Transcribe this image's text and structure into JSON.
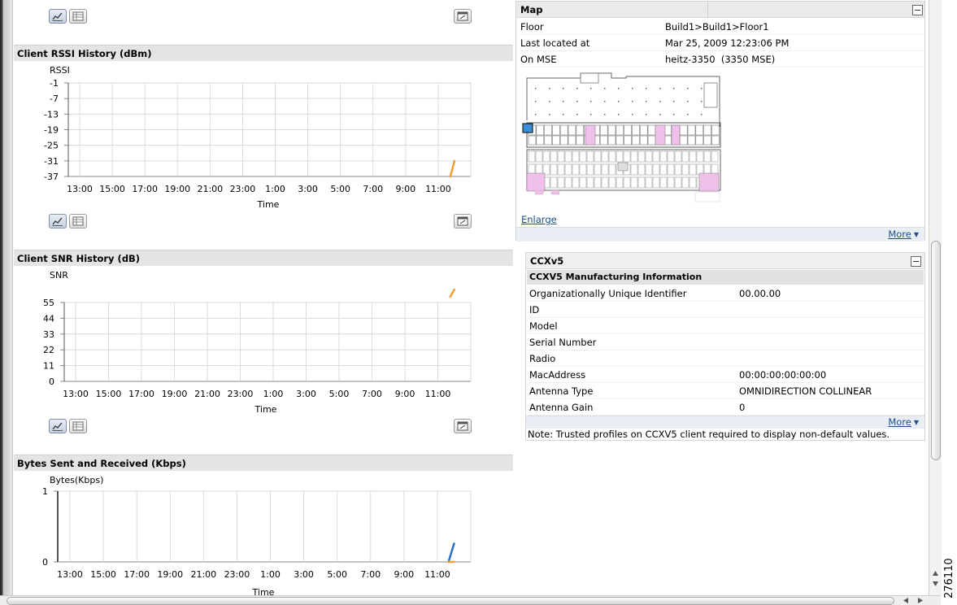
{
  "charts": {
    "rssi": {
      "title": "Client RSSI History (dBm)",
      "ylabel": "RSSI",
      "xlabel": "Time",
      "yticks": [
        "-1",
        "-7",
        "-13",
        "-19",
        "-25",
        "-31",
        "-37"
      ],
      "xticks": [
        "13:00",
        "15:00",
        "17:00",
        "19:00",
        "21:00",
        "23:00",
        "1:00",
        "3:00",
        "5:00",
        "7:00",
        "9:00",
        "11:00"
      ]
    },
    "snr": {
      "title": "Client SNR History (dB)",
      "ylabel": "SNR",
      "xlabel": "Time",
      "yticks": [
        "55",
        "44",
        "33",
        "22",
        "11",
        "0"
      ],
      "xticks": [
        "13:00",
        "15:00",
        "17:00",
        "19:00",
        "21:00",
        "23:00",
        "1:00",
        "3:00",
        "5:00",
        "7:00",
        "9:00",
        "11:00"
      ]
    },
    "bytes": {
      "title": "Bytes Sent and Received (Kbps)",
      "ylabel": "Bytes(Kbps)",
      "xlabel": "Time",
      "yticks": [
        "1",
        "0"
      ],
      "xticks": [
        "13:00",
        "15:00",
        "17:00",
        "19:00",
        "21:00",
        "23:00",
        "1:00",
        "3:00",
        "5:00",
        "7:00",
        "9:00",
        "11:00"
      ]
    }
  },
  "chart_data": [
    {
      "type": "line",
      "title": "Client RSSI History (dBm)",
      "ylabel": "RSSI",
      "xlabel": "Time",
      "ylim": [
        -37,
        -1
      ],
      "x": [
        "13:00",
        "15:00",
        "17:00",
        "19:00",
        "21:00",
        "23:00",
        "1:00",
        "3:00",
        "5:00",
        "7:00",
        "9:00",
        "11:00"
      ],
      "series": [
        {
          "color": "#f0a030",
          "points": [
            [
              "11:45",
              -37
            ],
            [
              "12:00",
              -31
            ]
          ]
        }
      ]
    },
    {
      "type": "line",
      "title": "Client SNR History (dB)",
      "ylabel": "SNR",
      "xlabel": "Time",
      "ylim": [
        0,
        55
      ],
      "x": [
        "13:00",
        "15:00",
        "17:00",
        "19:00",
        "21:00",
        "23:00",
        "1:00",
        "3:00",
        "5:00",
        "7:00",
        "9:00",
        "11:00"
      ],
      "series": [
        {
          "color": "#f0a030",
          "points": [
            [
              "11:45",
              59
            ],
            [
              "12:00",
              64
            ]
          ]
        }
      ]
    },
    {
      "type": "line",
      "title": "Bytes Sent and Received (Kbps)",
      "ylabel": "Bytes(Kbps)",
      "xlabel": "Time",
      "ylim": [
        0,
        1
      ],
      "x": [
        "13:00",
        "15:00",
        "17:00",
        "19:00",
        "21:00",
        "23:00",
        "1:00",
        "3:00",
        "5:00",
        "7:00",
        "9:00",
        "11:00"
      ],
      "series": [
        {
          "color": "#2e6fc4",
          "points": [
            [
              "11:40",
              0
            ],
            [
              "12:00",
              0.26
            ]
          ]
        },
        {
          "color": "#f0a030",
          "points": [
            [
              "11:40",
              0
            ],
            [
              "12:00",
              0
            ]
          ]
        }
      ]
    }
  ],
  "map": {
    "title": "Map",
    "rows": [
      {
        "label": "Floor",
        "value": "Build1>Build1>Floor1"
      },
      {
        "label": "Last located at",
        "value": "Mar 25, 2009 12:23:06 PM"
      },
      {
        "label": "On MSE",
        "value": "heitz-3350  (3350 MSE)"
      }
    ],
    "enlarge": "Enlarge",
    "more": "More"
  },
  "ccx": {
    "title": "CCXv5",
    "subtitle": "CCXV5 Manufacturing Information",
    "rows": [
      {
        "label": "Organizationally Unique Identifier",
        "value": "00.00.00"
      },
      {
        "label": "ID",
        "value": ""
      },
      {
        "label": "Model",
        "value": ""
      },
      {
        "label": "Serial Number",
        "value": ""
      },
      {
        "label": "Radio",
        "value": ""
      },
      {
        "label": "MacAddress",
        "value": "00:00:00:00:00:00"
      },
      {
        "label": "Antenna Type",
        "value": "OMNIDIRECTION COLLINEAR"
      },
      {
        "label": "Antenna Gain",
        "value": "0"
      }
    ],
    "more": "More",
    "note": "Note: Trusted profiles on CCXV5 client required to display non-default values."
  },
  "figure_number": "276110",
  "colors": {
    "orange_series": "#f0a030",
    "blue_series": "#2e6fc4",
    "link": "#1f4f8f"
  }
}
